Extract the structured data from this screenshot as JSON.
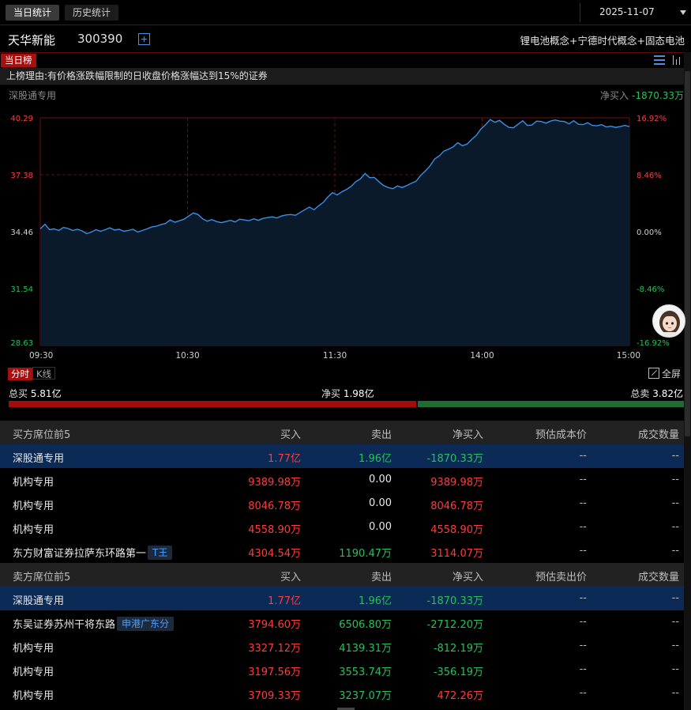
{
  "tabs": [
    "当日统计",
    "历史统计"
  ],
  "date": "2025-11-07",
  "stock": {
    "name": "天华新能",
    "code": "300390",
    "concepts": "锂电池概念+宁德时代概念+固态电池"
  },
  "list_tag": "当日榜",
  "reason": "上榜理由:有价格涨跌幅限制的日收盘价格涨幅达到15%的证券",
  "chart_header": {
    "left": "深股通专用",
    "net_label": "净买入",
    "net_value": "-1870.33万"
  },
  "colors": {
    "up": "#ff3b3b",
    "down": "#27c15a",
    "line": "#3a8ee6",
    "highlight_row": "#0c2a56"
  },
  "chart_data": {
    "type": "line",
    "title": "",
    "x_ticks": [
      "09:30",
      "10:30",
      "11:30",
      "14:00",
      "15:00"
    ],
    "y_ticks": [
      "40.29",
      "37.38",
      "34.46",
      "31.54",
      "28.63"
    ],
    "y2_ticks": [
      "16.92%",
      "8.46%",
      "0.00%",
      "-8.46%",
      "-16.92%"
    ],
    "ylim": [
      28.63,
      40.29
    ],
    "prev_close": 34.46,
    "grid": true,
    "series": [
      {
        "values": [
          34.6,
          34.84,
          34.56,
          34.6,
          34.52,
          34.68,
          34.62,
          34.52,
          34.58,
          34.5,
          34.36,
          34.44,
          34.56,
          34.48,
          34.56,
          34.66,
          34.54,
          34.58,
          34.48,
          34.52,
          34.58,
          34.44,
          34.52,
          34.6,
          34.7,
          34.74,
          34.82,
          34.88,
          35.06,
          34.94,
          35.02,
          35.1,
          35.26,
          35.42,
          35.34,
          35.12,
          35.0,
          35.08,
          34.98,
          34.92,
          34.98,
          35.04,
          34.96,
          35.1,
          35.06,
          35.02,
          35.12,
          35.04,
          35.14,
          35.18,
          35.22,
          35.16,
          35.26,
          35.32,
          35.34,
          35.3,
          35.44,
          35.58,
          35.72,
          35.58,
          35.78,
          35.96,
          36.24,
          36.46,
          36.34,
          36.5,
          36.62,
          36.78,
          37.02,
          37.16,
          37.44,
          37.22,
          37.24,
          37.02,
          36.82,
          36.72,
          36.66,
          36.8,
          36.72,
          36.82,
          36.94,
          37.04,
          37.34,
          37.56,
          37.82,
          38.18,
          38.34,
          38.58,
          38.68,
          38.8,
          39.02,
          38.86,
          38.94,
          39.18,
          39.4,
          39.72,
          39.94,
          40.2,
          40.06,
          40.16,
          39.96,
          39.8,
          39.78,
          39.96,
          40.14,
          39.9,
          39.92,
          40.12,
          40.1,
          40.02,
          40.12,
          40.18,
          40.12,
          40.1,
          39.98,
          40.14,
          39.96,
          39.94,
          40.04,
          39.9,
          39.88,
          39.94,
          39.82,
          39.86,
          39.8,
          39.84,
          39.9,
          39.84
        ]
      }
    ]
  },
  "chart_tabs": {
    "intraday": "分时",
    "kline": "K线",
    "fullscreen": "全屏"
  },
  "totals": {
    "buy_label": "总买",
    "buy_value": "5.81亿",
    "net_label": "净买",
    "net_value": "1.98亿",
    "sell_label": "总卖",
    "sell_value": "3.82亿",
    "buy_ratio": 0.604
  },
  "buy_table": {
    "headers": [
      "买方席位前5",
      "买入",
      "卖出",
      "净买入",
      "预估成本价",
      "成交数量"
    ],
    "rows": [
      {
        "name": "深股通专用",
        "badge": "",
        "buy": "1.77亿",
        "sell": "1.96亿",
        "net": "-1870.33万",
        "cost": "--",
        "vol": "--"
      },
      {
        "name": "机构专用",
        "badge": "",
        "buy": "9389.98万",
        "sell": "0.00",
        "net": "9389.98万",
        "cost": "--",
        "vol": "--"
      },
      {
        "name": "机构专用",
        "badge": "",
        "buy": "8046.78万",
        "sell": "0.00",
        "net": "8046.78万",
        "cost": "--",
        "vol": "--"
      },
      {
        "name": "机构专用",
        "badge": "",
        "buy": "4558.90万",
        "sell": "0.00",
        "net": "4558.90万",
        "cost": "--",
        "vol": "--"
      },
      {
        "name": "东方财富证券拉萨东环路第一",
        "badge": "T王",
        "buy": "4304.54万",
        "sell": "1190.47万",
        "net": "3114.07万",
        "cost": "--",
        "vol": "--"
      }
    ]
  },
  "sell_table": {
    "headers": [
      "卖方席位前5",
      "买入",
      "卖出",
      "净买入",
      "预估卖出价",
      "成交数量"
    ],
    "rows": [
      {
        "name": "深股通专用",
        "badge": "",
        "buy": "1.77亿",
        "sell": "1.96亿",
        "net": "-1870.33万",
        "cost": "--",
        "vol": "--"
      },
      {
        "name": "东吴证券苏州干将东路",
        "badge": "申港广东分",
        "buy": "3794.60万",
        "sell": "6506.80万",
        "net": "-2712.20万",
        "cost": "--",
        "vol": "--"
      },
      {
        "name": "机构专用",
        "badge": "",
        "buy": "3327.12万",
        "sell": "4139.31万",
        "net": "-812.19万",
        "cost": "--",
        "vol": "--"
      },
      {
        "name": "机构专用",
        "badge": "",
        "buy": "3197.56万",
        "sell": "3553.74万",
        "net": "-356.19万",
        "cost": "--",
        "vol": "--"
      },
      {
        "name": "机构专用",
        "badge": "",
        "buy": "3709.33万",
        "sell": "3237.07万",
        "net": "472.26万",
        "cost": "--",
        "vol": "--"
      }
    ]
  }
}
